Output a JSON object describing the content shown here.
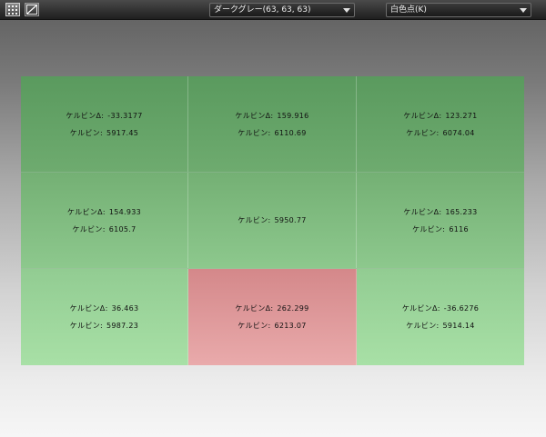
{
  "toolbar": {
    "icons": [
      "grid-view-icon",
      "curve-view-icon"
    ],
    "display_mode_select": {
      "value": "ダークグレー(63, 63, 63)"
    },
    "white_point_select": {
      "value": "白色点(K)"
    }
  },
  "colors": {
    "green_top": "#5a9a5e",
    "green_bottom": "#a8e0a6",
    "red_top": "#d4888a",
    "red_bottom": "#e9aaab"
  },
  "cells": [
    {
      "delta_label": "ケルビンΔ:",
      "delta_value": "-33.3177",
      "kelvin_label": "ケルビン:",
      "kelvin_value": "5917.45",
      "status": "ok"
    },
    {
      "delta_label": "ケルビンΔ:",
      "delta_value": "159.916",
      "kelvin_label": "ケルビン:",
      "kelvin_value": "6110.69",
      "status": "ok"
    },
    {
      "delta_label": "ケルビンΔ:",
      "delta_value": "123.271",
      "kelvin_label": "ケルビン:",
      "kelvin_value": "6074.04",
      "status": "ok"
    },
    {
      "delta_label": "ケルビンΔ:",
      "delta_value": "154.933",
      "kelvin_label": "ケルビン:",
      "kelvin_value": "6105.7",
      "status": "ok"
    },
    {
      "delta_label": "",
      "delta_value": "",
      "kelvin_label": "ケルビン:",
      "kelvin_value": "5950.77",
      "status": "ok"
    },
    {
      "delta_label": "ケルビンΔ:",
      "delta_value": "165.233",
      "kelvin_label": "ケルビン:",
      "kelvin_value": "6116",
      "status": "ok"
    },
    {
      "delta_label": "ケルビンΔ:",
      "delta_value": "36.463",
      "kelvin_label": "ケルビン:",
      "kelvin_value": "5987.23",
      "status": "ok"
    },
    {
      "delta_label": "ケルビンΔ:",
      "delta_value": "262.299",
      "kelvin_label": "ケルビン:",
      "kelvin_value": "6213.07",
      "status": "warn"
    },
    {
      "delta_label": "ケルビンΔ:",
      "delta_value": "-36.6276",
      "kelvin_label": "ケルビン:",
      "kelvin_value": "5914.14",
      "status": "ok"
    }
  ]
}
